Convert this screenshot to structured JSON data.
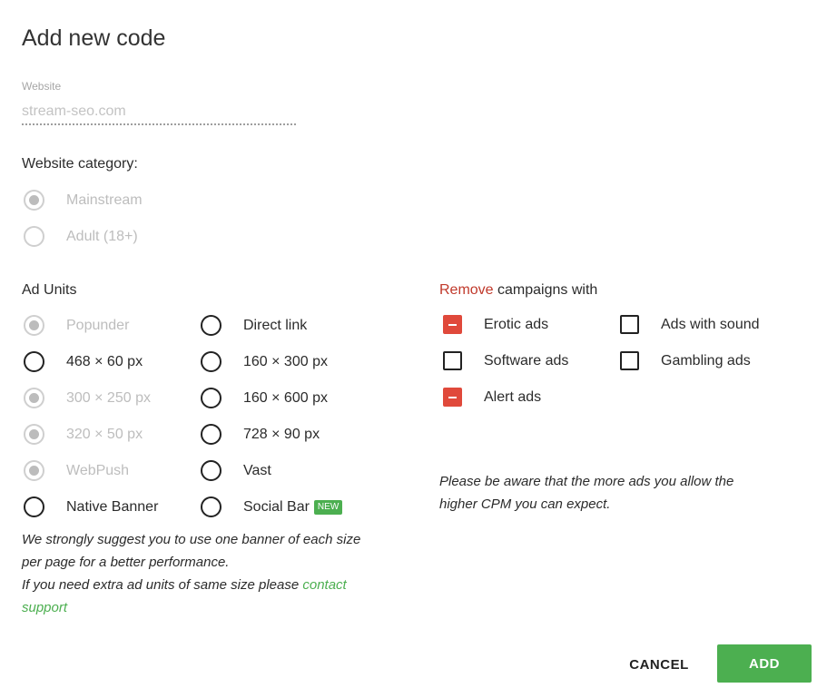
{
  "dialog": {
    "title": "Add new code"
  },
  "website": {
    "label": "Website",
    "value": "stream-seo.com"
  },
  "category": {
    "heading": "Website category:",
    "options": [
      {
        "label": "Mainstream",
        "selected": true,
        "disabled": true
      },
      {
        "label": "Adult (18+)",
        "selected": false,
        "disabled": true
      }
    ]
  },
  "ad_units": {
    "heading": "Ad Units",
    "left": [
      {
        "label": "Popunder",
        "selected": true,
        "disabled": true
      },
      {
        "label": "468 × 60 px",
        "selected": false,
        "disabled": false
      },
      {
        "label": "300 × 250 px",
        "selected": true,
        "disabled": true
      },
      {
        "label": "320 × 50 px",
        "selected": true,
        "disabled": true
      },
      {
        "label": "WebPush",
        "selected": true,
        "disabled": true
      },
      {
        "label": "Native Banner",
        "selected": false,
        "disabled": false
      }
    ],
    "right": [
      {
        "label": "Direct link",
        "selected": false,
        "disabled": false
      },
      {
        "label": "160 × 300 px",
        "selected": false,
        "disabled": false
      },
      {
        "label": "160 × 600 px",
        "selected": false,
        "disabled": false
      },
      {
        "label": "728 × 90 px",
        "selected": false,
        "disabled": false
      },
      {
        "label": "Vast",
        "selected": false,
        "disabled": false
      },
      {
        "label": "Social Bar",
        "selected": false,
        "disabled": false,
        "badge": "NEW"
      }
    ],
    "suggestion_line1": "We strongly suggest you to use one banner of each size",
    "suggestion_line2": "per page for a better performance.",
    "suggestion_line3": "If you need extra ad units of same size please",
    "contact_link_part1": "contact",
    "contact_link_part2": "support"
  },
  "remove": {
    "heading_red": "Remove",
    "heading_rest": "campaigns with",
    "left": [
      {
        "label": "Erotic ads",
        "checked": true
      },
      {
        "label": "Software ads",
        "checked": false
      },
      {
        "label": "Alert ads",
        "checked": true
      }
    ],
    "right": [
      {
        "label": "Ads with sound",
        "checked": false
      },
      {
        "label": "Gambling ads",
        "checked": false
      }
    ],
    "note_line1": "Please be aware that the more ads you allow the",
    "note_line2": "higher CPM you can expect."
  },
  "buttons": {
    "cancel": "CANCEL",
    "add": "ADD"
  },
  "colors": {
    "accent_green": "#4caf50",
    "remove_red": "#e0493b"
  }
}
